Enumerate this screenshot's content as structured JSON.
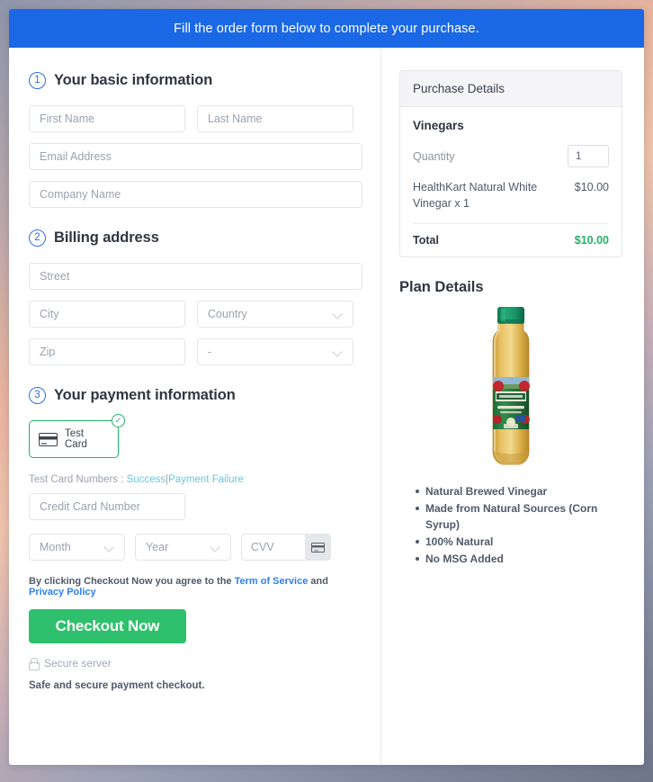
{
  "banner": {
    "message": "Fill the order form below to complete your purchase."
  },
  "sections": {
    "basic": {
      "number": "1",
      "title": "Your basic information",
      "fields": {
        "first_name": "First Name",
        "last_name": "Last Name",
        "email": "Email Address",
        "company": "Company Name"
      }
    },
    "billing": {
      "number": "2",
      "title": "Billing address",
      "fields": {
        "street": "Street",
        "city": "City",
        "country": "Country",
        "zip": "Zip",
        "state": "-"
      }
    },
    "payment": {
      "number": "3",
      "title": "Your payment information",
      "card_tile_label": "Test Card",
      "card_tile_icon": "credit-card-icon",
      "selected_badge_icon": "check-circle-icon",
      "test_cards_prefix": "Test Card Numbers :",
      "test_card_success": "Success",
      "test_card_separator": "|",
      "test_card_failure": "Payment Failure",
      "fields": {
        "card_number": "Credit Card Number",
        "month": "Month",
        "year": "Year",
        "cvv": "CVV"
      },
      "cvv_icon": "credit-card-icon"
    }
  },
  "footer": {
    "terms_prefix": "By clicking Checkout Now you agree to the",
    "terms_link": "Term of Service",
    "terms_and": "and",
    "privacy_link": "Privacy Policy",
    "checkout_label": "Checkout Now",
    "secure_icon": "lock-icon",
    "secure_label": "Secure server",
    "safe_note": "Safe and secure payment checkout."
  },
  "purchase": {
    "header": "Purchase Details",
    "group_name": "Vinegars",
    "quantity_label": "Quantity",
    "quantity_value": "1",
    "item_name": "HealthKart Natural White Vinegar x 1",
    "item_price": "$10.00",
    "total_label": "Total",
    "total_value": "$10.00"
  },
  "plan": {
    "title": "Plan Details",
    "product_image": "apple-cider-vinegar-bottle",
    "features": [
      "Natural Brewed Vinegar",
      "Made from Natural Sources (Corn Syrup)",
      "100% Natural",
      "No MSG Added"
    ]
  },
  "colors": {
    "banner_blue": "#1a68e5",
    "step_blue": "#2a6fe0",
    "accent_green": "#2ec06c",
    "total_green": "#26b263",
    "link_blue": "#2f7fe8",
    "test_link": "#64c8e0"
  }
}
